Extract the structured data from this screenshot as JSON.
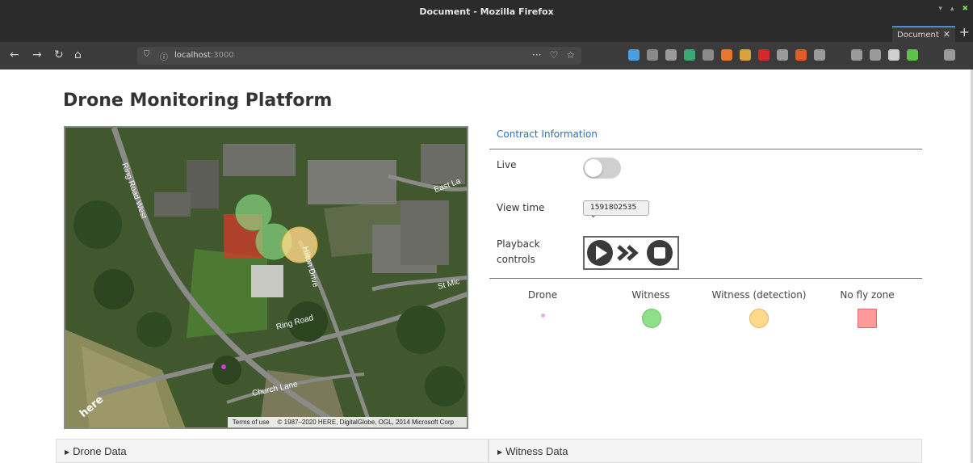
{
  "window": {
    "title": "Document - Mozilla Firefox"
  },
  "tab": {
    "label": "Document",
    "close": "✕",
    "new": "+"
  },
  "urlbar": {
    "host": "localhost",
    "port": ":3000",
    "menu": "···"
  },
  "page": {
    "title": "Drone Monitoring Platform"
  },
  "map": {
    "labels": {
      "ring_road_west": "Ring Road West",
      "east": "East La",
      "st_mic": "St Mic",
      "ring_road": "Ring Road",
      "church_lane": "Church Lane",
      "hilton": "Hilton Drive"
    },
    "attribution": {
      "terms": "Terms of use",
      "copyright": "© 1987–2020 HERE, DigitalGlobe, OGL, 2014 Microsoft Corp"
    },
    "logo": "here"
  },
  "panel": {
    "header": "Contract Information",
    "live_label": "Live",
    "live_on": false,
    "view_time_label": "View time",
    "view_time_value": "1591802535 ⌄",
    "playback_label_1": "Playback",
    "playback_label_2": "controls"
  },
  "legend": {
    "drone": "Drone",
    "witness": "Witness",
    "witness_detection": "Witness (detection)",
    "no_fly": "No fly zone",
    "colors": {
      "drone": "#f4a7e6",
      "witness": "#8de08a",
      "witness_detection": "#ffd98a",
      "no_fly": "#ff9a9a"
    }
  },
  "accordions": {
    "drone": "Drone Data",
    "witness": "Witness Data"
  }
}
